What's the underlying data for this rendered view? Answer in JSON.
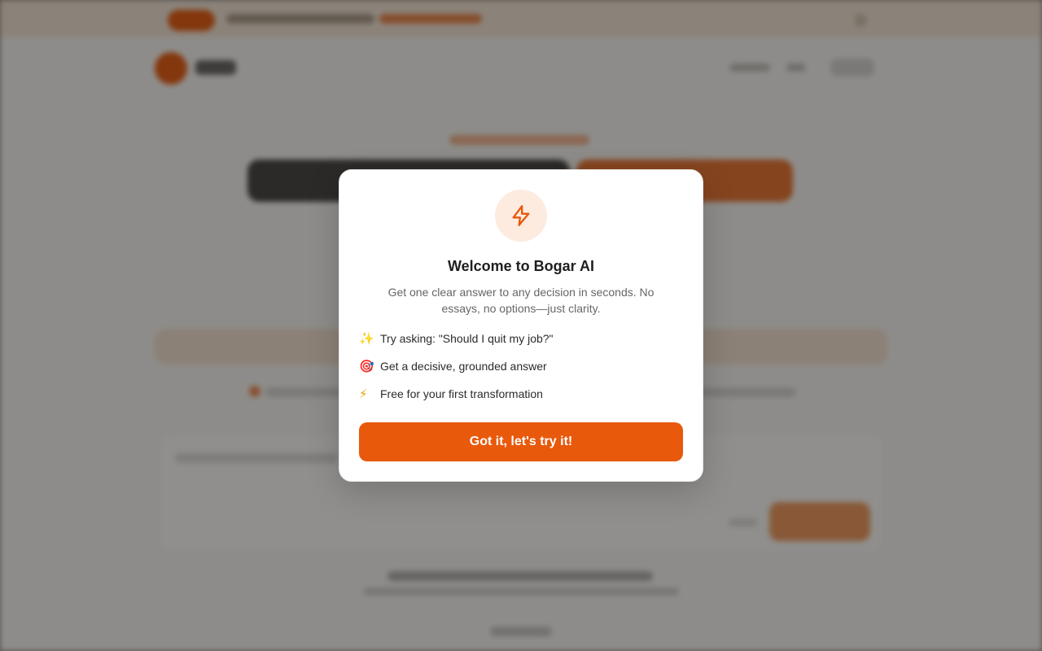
{
  "modal": {
    "title": "Welcome to Bogar AI",
    "description": "Get one clear answer to any decision in seconds. No essays, no options—just clarity.",
    "icon": "lightning-icon",
    "features": [
      {
        "icon": "sparkles-icon",
        "glyph": "✨",
        "text": "Try asking: \"Should I quit my job?\""
      },
      {
        "icon": "target-icon",
        "glyph": "🎯",
        "text": "Get a decisive, grounded answer"
      },
      {
        "icon": "lightning-icon",
        "glyph": "⚡",
        "text": "Free for your first transformation"
      }
    ],
    "cta_label": "Got it, let's try it!"
  },
  "colors": {
    "accent": "#e8590c",
    "accent_soft": "#fdebe0",
    "overlay": "rgba(20,16,12,0.47)"
  }
}
